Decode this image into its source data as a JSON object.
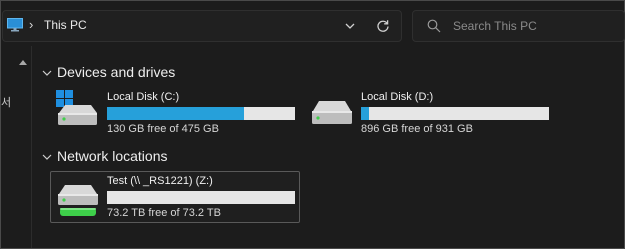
{
  "addressbar": {
    "location": "This PC",
    "pc_icon": "computer-icon",
    "separator_icon": "chevron-right-icon",
    "dropdown_icon": "chevron-down-icon",
    "refresh_icon": "refresh-icon"
  },
  "search": {
    "placeholder": "Search This PC",
    "icon": "search-icon"
  },
  "nav_pane": {
    "fragment": "서"
  },
  "groups": [
    {
      "title": "Devices and drives",
      "drives": [
        {
          "name": "Local Disk (C:)",
          "free": "130 GB free of 475 GB",
          "used_fraction": 0.73,
          "icon": "windows-drive-icon"
        },
        {
          "name": "Local Disk (D:)",
          "free": "896 GB free of 931 GB",
          "used_fraction": 0.04,
          "icon": "hard-drive-icon"
        }
      ]
    },
    {
      "title": "Network locations",
      "drives": [
        {
          "name": "Test (\\\\            _RS1221) (Z:)",
          "free": "73.2 TB free of 73.2 TB",
          "used_fraction": 0.0,
          "icon": "network-drive-icon"
        }
      ]
    }
  ],
  "colors": {
    "accent": "#26a0da",
    "bar_track": "#e6e6e6",
    "background": "#1c1c1c",
    "network_led": "#3ecf4a"
  }
}
